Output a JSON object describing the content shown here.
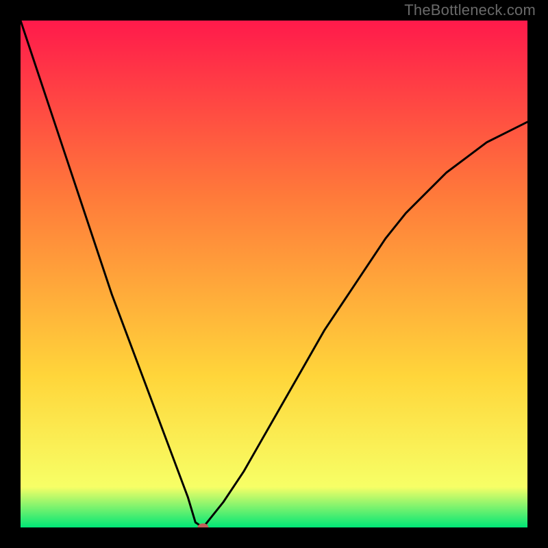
{
  "watermark": "TheBottleneck.com",
  "chart_data": {
    "type": "line",
    "title": "",
    "xlabel": "",
    "ylabel": "",
    "xlim": [
      0,
      100
    ],
    "ylim": [
      0,
      100
    ],
    "background_gradient": {
      "colors": [
        "#ff1a4b",
        "#ff7b3a",
        "#ffd53a",
        "#f7ff66",
        "#00e676"
      ],
      "positions": [
        0,
        35,
        70,
        92,
        100
      ]
    },
    "series": [
      {
        "name": "bottleneck-curve",
        "x": [
          0,
          3,
          6,
          9,
          12,
          15,
          18,
          21,
          24,
          27,
          30,
          33,
          34.5,
          36,
          40,
          44,
          48,
          52,
          56,
          60,
          64,
          68,
          72,
          76,
          80,
          84,
          88,
          92,
          96,
          100
        ],
        "values": [
          100,
          91,
          82,
          73,
          64,
          55,
          46,
          38,
          30,
          22,
          14,
          6,
          1,
          0,
          5,
          11,
          18,
          25,
          32,
          39,
          45,
          51,
          57,
          62,
          66,
          70,
          73,
          76,
          78,
          80
        ],
        "color": "#000000",
        "width": 3
      }
    ],
    "marker": {
      "x": 36,
      "y": 0,
      "color": "#c0605a",
      "rx": 8,
      "ry": 6
    }
  }
}
